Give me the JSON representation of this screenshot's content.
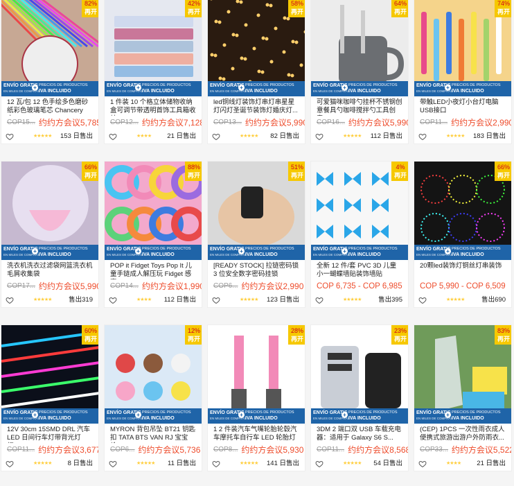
{
  "banner": {
    "free_shipping": "ENVÍO GRATIS",
    "free_shipping_sub": "EN MILES DE COMPRAS",
    "plus": "+",
    "prices_line": "PRECIOS DE PRODUCTOS",
    "iva": "IVA INCLUIDO"
  },
  "products": [
    {
      "title": "12 瓦/包 12 色手绘多色磨砂纸彩色玻璃笔芯 Chancery 中...",
      "old": "COP15...",
      "price": "约约方会议5,785",
      "badge_pct": "82%",
      "badge_off": "再开",
      "stars": "★★★★★",
      "sold": "153 日售出",
      "bg": "#c7a894"
    },
    {
      "title": "1 件装 10 个格立体储物收纳盒可调节带透明首饰工具箱收纳",
      "old": "COP12...",
      "price": "约约方会议7,128",
      "badge_pct": "42%",
      "badge_off": "再开",
      "stars": "★★★★",
      "sold": "21 日售出",
      "bg": "#e5e8f0"
    },
    {
      "title": "led铜线灯装饰灯串灯串星星灯闪灯圣诞节装饰灯婚庆灯...",
      "old": "COP13...",
      "price": "约约方会议5,990",
      "badge_pct": "58%",
      "badge_off": "再开",
      "stars": "★★★★★",
      "sold": "82 日售出",
      "bg": "#2a1b10"
    },
    {
      "title": "可爱猫咪咖啡勺挂杯不锈钢创意餐具勺咖啡搅拌勺工具创意...",
      "old": "COP16...",
      "price": "约约方会议5,990",
      "badge_pct": "64%",
      "badge_off": "再开",
      "stars": "★★★★★",
      "sold": "112 日售出",
      "bg": "#ececec"
    },
    {
      "title": "带触LED小夜灯小台灯电脑USB接口",
      "old": "COP11...",
      "price": "约约方会议2,990",
      "badge_pct": "74%",
      "badge_off": "再开",
      "stars": "★★★★★",
      "sold": "183 日售出",
      "bg": "#f5d48b"
    },
    {
      "title": "洗衣机洗衣过滤袋网篮洗衣机毛屑收集袋",
      "old": "COP17...",
      "price": "约约方会议5,990",
      "badge_pct": "66%",
      "badge_off": "再开",
      "stars": "★★★★★",
      "sold": "售出319",
      "bg": "#c6b9d0"
    },
    {
      "title": "POP it Fidget Toys Pop It 儿童手链成人解压玩 Fidget 感官...",
      "old": "COP14...",
      "price": "约约方会议1,990",
      "badge_pct": "88%",
      "badge_off": "再开",
      "stars": "★★★★",
      "sold": "112 日售出",
      "bg": "#f3a9cc"
    },
    {
      "title": "[READY STOCK] 拉链密码锁 3 位安全数字密码挂锁",
      "old": "COP6...",
      "price": "约约方会议2,990",
      "badge_pct": "51%",
      "badge_off": "再开",
      "stars": "★★★★★",
      "sold": "123 日售出",
      "bg": "#d9d9d9"
    },
    {
      "title": "全新 12 件/套 PVC 3D 儿童小一蝴蝶墙贴装饰墙贴",
      "old": "",
      "price": "COP 6,735 - COP 6,985",
      "badge_pct": "4%",
      "badge_off": "再开",
      "stars": "★★★★★",
      "sold": "售出395",
      "bg": "#f7f7f7"
    },
    {
      "title": "20颗led装饰灯铜丝灯串装饰",
      "old": "",
      "price": "COP 5,990 - COP 6,509",
      "badge_pct": "66%",
      "badge_off": "再开",
      "stars": "★★★★★",
      "sold": "售出690",
      "bg": "#141414"
    },
    {
      "title": "12V 30cm 15SMD DRL 汽车 LED 日间行车灯带背光灯灯...",
      "old": "COP11...",
      "price": "约约方会议3,677",
      "badge_pct": "60%",
      "badge_off": "再开",
      "stars": "★★★★★",
      "sold": "8 日售出",
      "bg": "#0b0f1a"
    },
    {
      "title": "MYRON 背包吊坠 BT21 钥匙扣 TATA BTS VAN RJ 宝宝蛛...",
      "old": "COP6...",
      "price": "约约方会议5,736",
      "badge_pct": "12%",
      "badge_off": "再开",
      "stars": "★★★★★",
      "sold": "11 日售出",
      "bg": "#dbe9f6"
    },
    {
      "title": "1 2 件装汽车气嘴轮胎轮毂汽车摩托车自行车 LED 轮胎灯",
      "old": "COP8...",
      "price": "约约方会议5,930",
      "badge_pct": "28%",
      "badge_off": "再开",
      "stars": "★★★★★",
      "sold": "141 日售出",
      "bg": "#ffffff"
    },
    {
      "title": "3DM 2 端口双 USB 车载充电器：适用于 Galaxy S6 S...",
      "old": "COP11...",
      "price": "约约方会议8,568",
      "badge_pct": "23%",
      "badge_off": "再开",
      "stars": "★★★★★",
      "sold": "54 日售出",
      "bg": "#ffffff"
    },
    {
      "title": "(CEP) 1PCS 一次性雨衣成人便携式旅游出游户外防雨衣...",
      "old": "COP33...",
      "price": "约约方会议5,522",
      "badge_pct": "83%",
      "badge_off": "再开",
      "stars": "★★★★",
      "sold": "21 日售出",
      "bg": "#6f9b5a"
    }
  ]
}
